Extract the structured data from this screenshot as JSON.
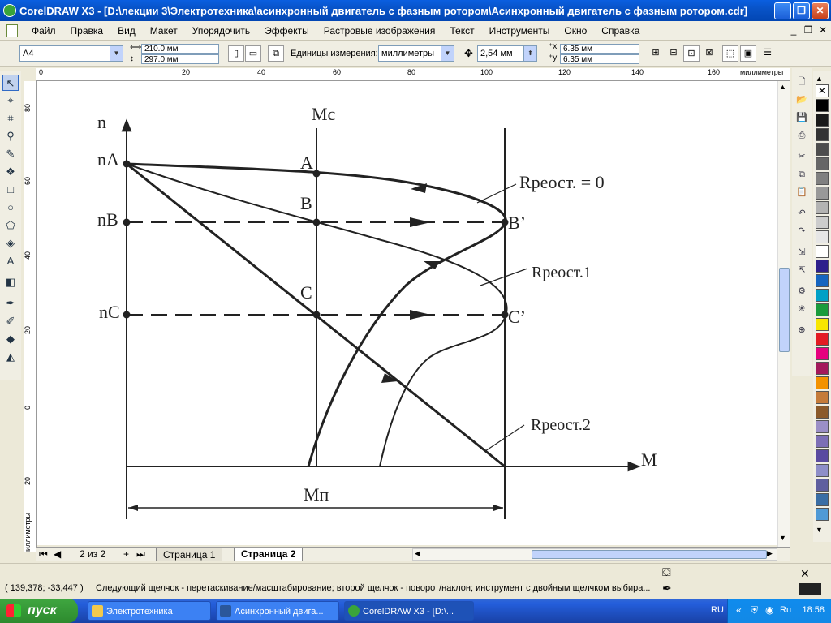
{
  "window": {
    "title": "CorelDRAW X3 - [D:\\лекции 3\\Электротехника\\асинхронный двигатель с фазным ротором\\Асинхронный двигатель с фазным ротором.cdr]",
    "min": "_",
    "max": "❐",
    "close": "✕"
  },
  "menu": {
    "items": [
      "Файл",
      "Правка",
      "Вид",
      "Макет",
      "Упорядочить",
      "Эффекты",
      "Растровые изображения",
      "Текст",
      "Инструменты",
      "Окно",
      "Справка"
    ],
    "doc_min": "_",
    "doc_restore": "❐",
    "doc_close": "✕"
  },
  "propbar": {
    "page_size": "A4",
    "width": "210.0 мм",
    "height": "297.0 мм",
    "units_label": "Единицы измерения:",
    "units_value": "миллиметры",
    "nudge": "2,54 мм",
    "dup_x": "6.35 мм",
    "dup_y": "6.35 мм"
  },
  "hruler": {
    "labels": [
      "0",
      "20",
      "40",
      "60",
      "80",
      "100",
      "120",
      "140",
      "160"
    ],
    "unit": "миллиметры"
  },
  "vruler": {
    "labels": [
      "80",
      "60",
      "40",
      "20",
      "0",
      "20"
    ],
    "unit": "миллиметры"
  },
  "diagram": {
    "axis_n": "n",
    "axis_m": "M",
    "mc": "Mc",
    "mp": "Mп",
    "nA": "nA",
    "nB": "nB",
    "nC": "nC",
    "A": "A",
    "B": "B",
    "C": "C",
    "Bp": "B’",
    "Cp": "C’",
    "r0": "Rреост. = 0",
    "r1": "Rреост.1",
    "r2": "Rреост.2"
  },
  "pages": {
    "counter": "2 из 2",
    "tab1": "Страница 1",
    "tab2": "Страница 2"
  },
  "status": {
    "coords": "( 139,378; -33,447 )",
    "hint": "Следующий щелчок - перетаскивание/масштабирование; второй щелчок - поворот/наклон; инструмент с двойным щелчком выбира..."
  },
  "taskbar": {
    "start": "пуск",
    "items": [
      "Электротехника",
      "Асинхронный двига...",
      "CorelDRAW X3 - [D:\\..."
    ],
    "lang": "RU",
    "tray_lang": "Ru",
    "clock": "18:58"
  },
  "colors": {
    "titlebar": "#0853C8",
    "taskbar": "#245EDB",
    "start": "#3FA640"
  }
}
